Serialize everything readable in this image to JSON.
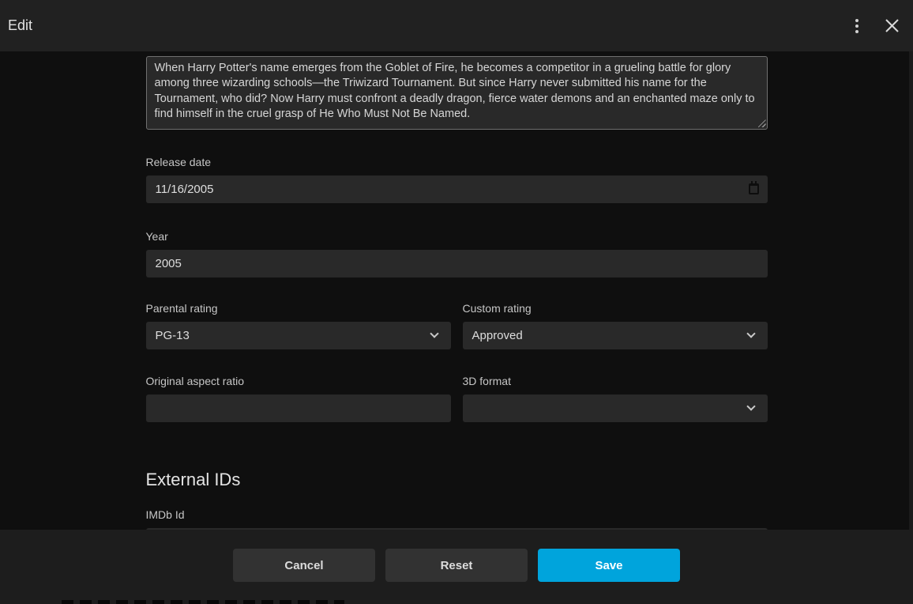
{
  "dialog": {
    "title": "Edit"
  },
  "form": {
    "overview": {
      "value": "When Harry Potter's name emerges from the Goblet of Fire, he becomes a competitor in a grueling battle for glory among three wizarding schools—the Triwizard Tournament. But since Harry never submitted his name for the Tournament, who did? Now Harry must confront a deadly dragon, fierce water demons and an enchanted maze only to find himself in the cruel grasp of He Who Must Not Be Named."
    },
    "release_date": {
      "label": "Release date",
      "value": "11/16/2005"
    },
    "year": {
      "label": "Year",
      "value": "2005"
    },
    "parental_rating": {
      "label": "Parental rating",
      "value": "PG-13"
    },
    "custom_rating": {
      "label": "Custom rating",
      "value": "Approved"
    },
    "original_aspect_ratio": {
      "label": "Original aspect ratio",
      "value": ""
    },
    "three_d_format": {
      "label": "3D format",
      "value": ""
    },
    "external_ids_heading": "External IDs",
    "imdb_id": {
      "label": "IMDb Id",
      "value": ""
    }
  },
  "footer": {
    "cancel_label": "Cancel",
    "reset_label": "Reset",
    "save_label": "Save"
  },
  "colors": {
    "accent": "#00a4dc",
    "header_bg": "#212121",
    "content_bg": "#0f0f0f",
    "footer_bg": "#1d1d1d",
    "input_bg": "#292929"
  }
}
